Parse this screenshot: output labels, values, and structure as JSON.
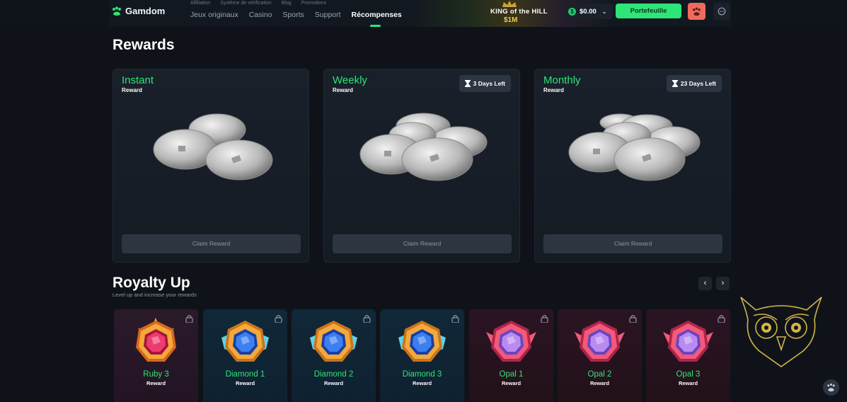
{
  "header": {
    "brand": "Gamdom",
    "subnav": [
      "Affiliation",
      "Système de vérification",
      "Blog",
      "Promotions"
    ],
    "nav": [
      "Jeux originaux",
      "Casino",
      "Sports",
      "Support",
      "Récompenses"
    ],
    "active_nav": "Récompenses",
    "promo_title": "KING of the HILL",
    "promo_amount": "$1M",
    "balance": "$0.00",
    "wallet_label": "Portefeuille",
    "colors": {
      "accent": "#2ee577",
      "avatar": "#ef6b5e"
    }
  },
  "rewards": {
    "title": "Rewards",
    "cards": [
      {
        "title": "Instant",
        "subtitle": "Reward",
        "days_left": "",
        "button": "Claim Reward"
      },
      {
        "title": "Weekly",
        "subtitle": "Reward",
        "days_left": "3 Days Left",
        "button": "Claim Reward"
      },
      {
        "title": "Monthly",
        "subtitle": "Reward",
        "days_left": "23 Days Left",
        "button": "Claim Reward"
      }
    ]
  },
  "royalty": {
    "title": "Royalty Up",
    "subtitle": "Level up and increase your rewards",
    "prev_icon": "‹",
    "next_icon": "›",
    "ranks": [
      {
        "name": "Ruby 3",
        "sub": "Reward",
        "tier": "ruby"
      },
      {
        "name": "Diamond 1",
        "sub": "Reward",
        "tier": "diamond"
      },
      {
        "name": "Diamond 2",
        "sub": "Reward",
        "tier": "diamond"
      },
      {
        "name": "Diamond 3",
        "sub": "Reward",
        "tier": "diamond"
      },
      {
        "name": "Opal 1",
        "sub": "Reward",
        "tier": "opal"
      },
      {
        "name": "Opal 2",
        "sub": "Reward",
        "tier": "opal"
      },
      {
        "name": "Opal 3",
        "sub": "Reward",
        "tier": "opal"
      }
    ]
  }
}
